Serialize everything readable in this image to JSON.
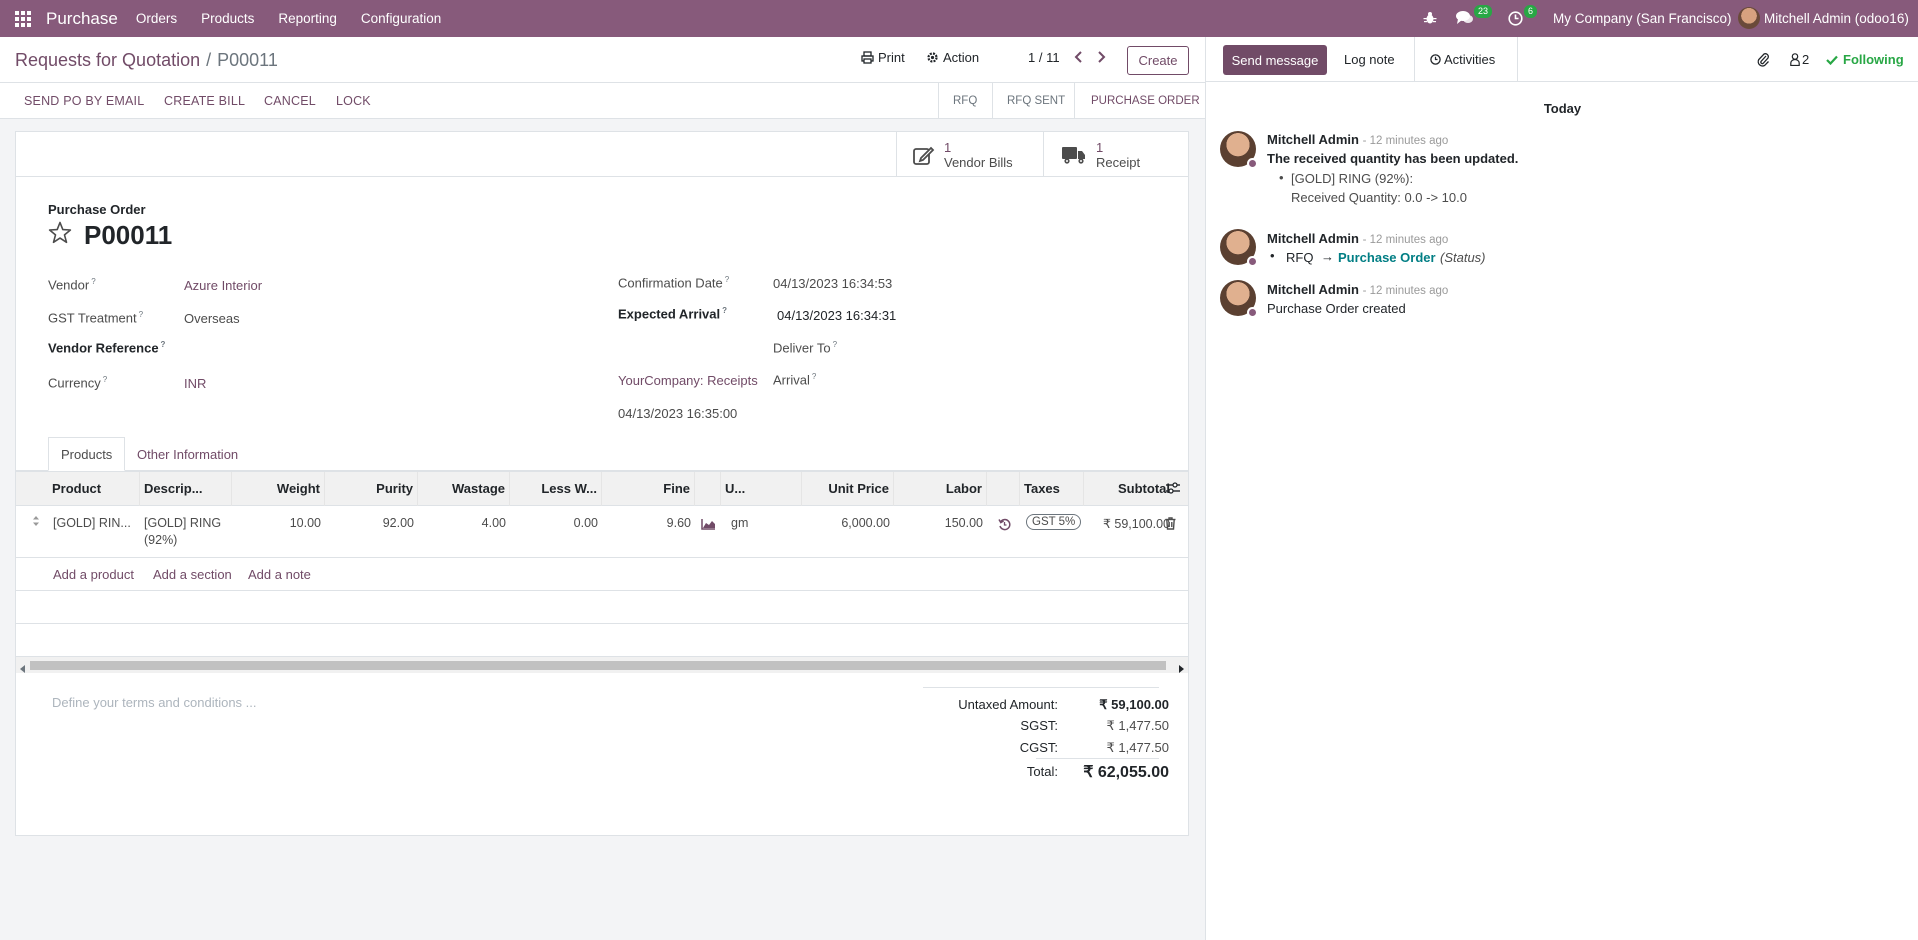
{
  "navbar": {
    "app_name": "Purchase",
    "menus": [
      "Orders",
      "Products",
      "Reporting",
      "Configuration"
    ],
    "messages_count": "23",
    "activities_count": "6",
    "company": "My Company (San Francisco)",
    "user": "Mitchell Admin (odoo16)"
  },
  "control_panel": {
    "breadcrumb_parent": "Requests for Quotation",
    "breadcrumb_sep": "/",
    "breadcrumb_current": "P00011",
    "print_label": "Print",
    "action_label": "Action",
    "pager": "1 / 11",
    "create_label": "Create"
  },
  "statusbar": {
    "buttons": [
      "SEND PO BY EMAIL",
      "CREATE BILL",
      "CANCEL",
      "LOCK"
    ],
    "stages": [
      "RFQ",
      "RFQ SENT",
      "PURCHASE ORDER"
    ],
    "active_stage": "PURCHASE ORDER"
  },
  "smart_buttons": {
    "vendor_bills_count": "1",
    "vendor_bills_label": "Vendor Bills",
    "receipt_count": "1",
    "receipt_label": "Receipt"
  },
  "form": {
    "doc_type": "Purchase Order",
    "name": "P00011",
    "q": "?",
    "vendor_label": "Vendor",
    "vendor": "Azure Interior",
    "gst_label": "GST Treatment",
    "gst": "Overseas",
    "vendor_ref_label": "Vendor Reference",
    "currency_label": "Currency",
    "currency": "INR",
    "confirmation_label": "Confirmation Date",
    "confirmation_date": "04/13/2023 16:34:53",
    "expected_label": "Expected Arrival",
    "expected_arrival": "04/13/2023 16:34:31",
    "deliver_to_label": "Deliver To",
    "picking_type": "YourCompany: Receipts",
    "arrival_label": "Arrival",
    "arrival_date": "04/13/2023 16:35:00"
  },
  "tabs": [
    "Products",
    "Other Information"
  ],
  "table": {
    "headers": [
      "Product",
      "Descrip...",
      "Weight",
      "Purity",
      "Wastage",
      "Less W...",
      "Fine",
      "U...",
      "Unit Price",
      "Labor",
      "Taxes",
      "Subtotal"
    ],
    "row": {
      "product": "[GOLD] RIN...",
      "description_1": "[GOLD] RING",
      "description_2": "(92%)",
      "weight": "10.00",
      "purity": "92.00",
      "wastage": "4.00",
      "less_weight": "0.00",
      "fine": "9.60",
      "uom": "gm",
      "unit_price": "6,000.00",
      "labor": "150.00",
      "tax": "GST 5%",
      "subtotal": "₹ 59,100.00"
    },
    "add_product": "Add a product",
    "add_section": "Add a section",
    "add_note": "Add a note"
  },
  "terms_placeholder": "Define your terms and conditions ...",
  "totals": {
    "untaxed_label": "Untaxed Amount:",
    "untaxed": "₹ 59,100.00",
    "sgst_label": "SGST:",
    "sgst": "₹ 1,477.50",
    "cgst_label": "CGST:",
    "cgst": "₹ 1,477.50",
    "total_label": "Total:",
    "total": "₹ 62,055.00"
  },
  "chatter": {
    "send_message": "Send message",
    "log_note": "Log note",
    "activities": "Activities",
    "followers_count": "2",
    "following": "Following",
    "date_separator": "Today",
    "messages": [
      {
        "author": "Mitchell Admin",
        "time": "- 12 minutes ago",
        "text": "The received quantity has been updated.",
        "bullet_1": "[GOLD] RING (92%):",
        "bullet_2": "Received Quantity: 0.0 -> 10.0"
      },
      {
        "author": "Mitchell Admin",
        "time": "- 12 minutes ago",
        "from": "RFQ",
        "arrow": "→",
        "to": "Purchase Order",
        "field": "(Status)"
      },
      {
        "author": "Mitchell Admin",
        "time": "- 12 minutes ago",
        "text": "Purchase Order created"
      }
    ]
  }
}
